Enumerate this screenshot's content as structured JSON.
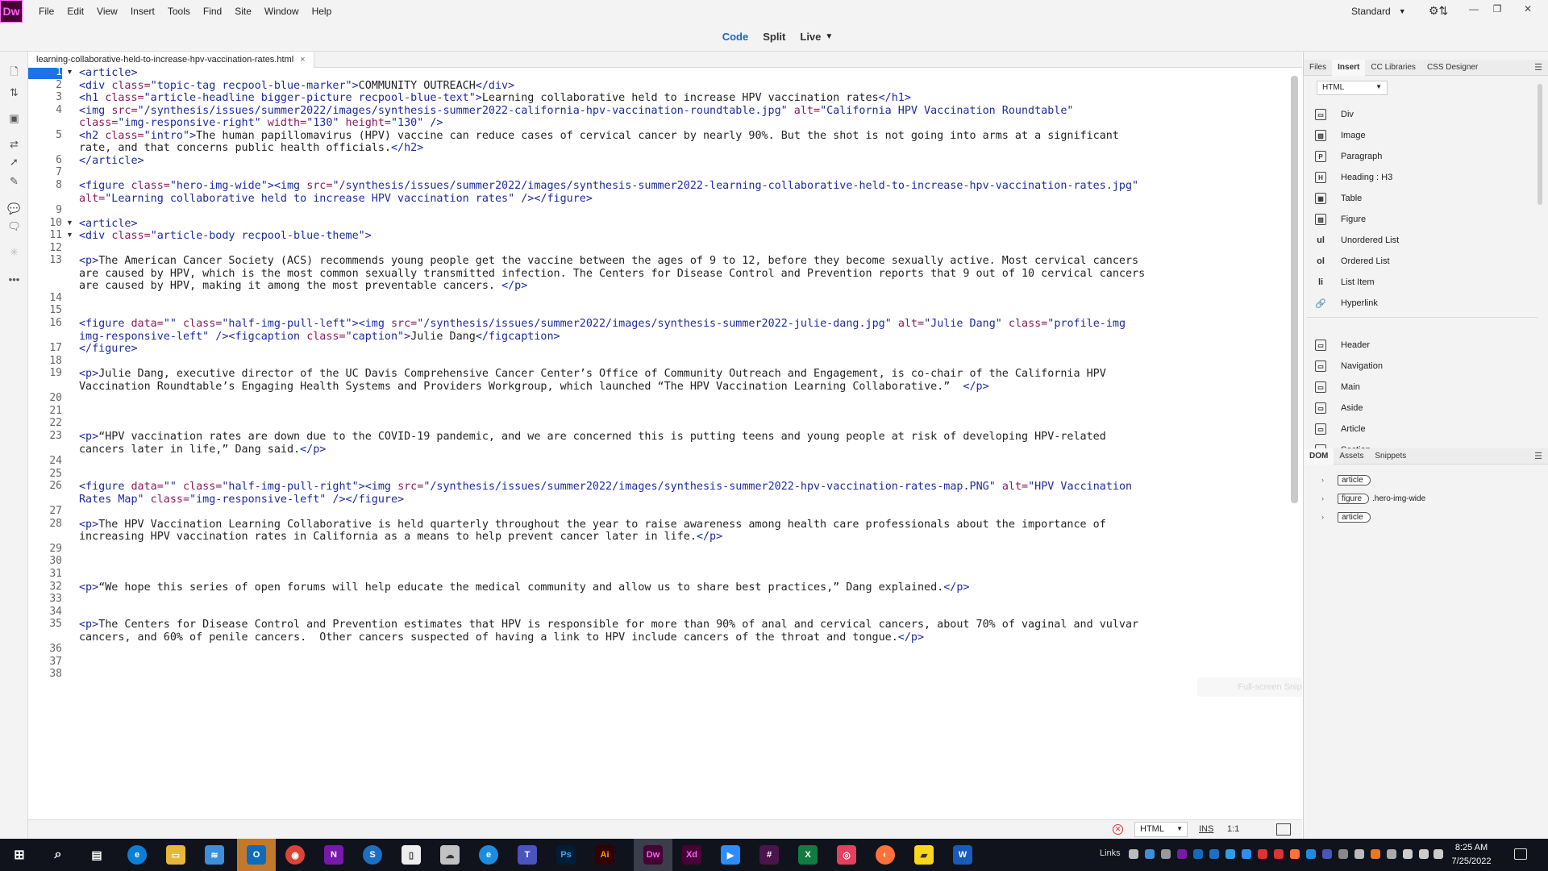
{
  "app": {
    "logo": "Dw",
    "workspace": "Standard"
  },
  "menu": [
    "File",
    "Edit",
    "View",
    "Insert",
    "Tools",
    "Find",
    "Site",
    "Window",
    "Help"
  ],
  "views": {
    "code": "Code",
    "split": "Split",
    "live": "Live"
  },
  "document": {
    "tab_name": "learning-collaborative-held-to-increase-hpv-vaccination-rates.html"
  },
  "editor": {
    "line_numbers": [
      "1",
      "2",
      "3",
      "4",
      "5",
      "6",
      "7",
      "8",
      "9",
      "10",
      "11",
      "12",
      "13",
      "14",
      "15",
      "16",
      "17",
      "18",
      "19",
      "20",
      "21",
      "22",
      "23",
      "24",
      "25",
      "26",
      "27",
      "28",
      "29",
      "30",
      "31",
      "32",
      "33",
      "34",
      "35",
      "36",
      "37",
      "38"
    ],
    "code_lines": [
      [
        [
          "tg",
          "<article>"
        ]
      ],
      [
        [
          "tg",
          "<div "
        ],
        [
          "at",
          "class="
        ],
        [
          "vl",
          "\"topic-tag recpool-blue-marker\""
        ],
        [
          "tg",
          ">"
        ],
        [
          "tx",
          "COMMUNITY OUTREACH"
        ],
        [
          "tg",
          "</div>"
        ]
      ],
      [
        [
          "tg",
          "<h1 "
        ],
        [
          "at",
          "class="
        ],
        [
          "vl",
          "\"article-headline bigger-picture recpool-blue-text\""
        ],
        [
          "tg",
          ">"
        ],
        [
          "tx",
          "Learning collaborative held to increase HPV vaccination rates"
        ],
        [
          "tg",
          "</h1>"
        ]
      ],
      [
        [
          "tg",
          "<img "
        ],
        [
          "at",
          "src="
        ],
        [
          "vl",
          "\"/synthesis/issues/summer2022/images/synthesis-summer2022-california-hpv-vaccination-roundtable.jpg\""
        ],
        [
          "at",
          " alt="
        ],
        [
          "vl",
          "\"California HPV Vaccination Roundtable\""
        ]
      ],
      [
        [
          "at",
          "class="
        ],
        [
          "vl",
          "\"img-responsive-right\""
        ],
        [
          "at",
          " width="
        ],
        [
          "vl",
          "\"130\""
        ],
        [
          "at",
          " height="
        ],
        [
          "vl",
          "\"130\""
        ],
        [
          "tg",
          " />"
        ]
      ],
      [
        [
          "tg",
          "<h2 "
        ],
        [
          "at",
          "class="
        ],
        [
          "vl",
          "\"intro\""
        ],
        [
          "tg",
          ">"
        ],
        [
          "tx",
          "The human papillomavirus (HPV) vaccine can reduce cases of cervical cancer by nearly 90%. But the shot is not going into arms at a significant"
        ]
      ],
      [
        [
          "tx",
          "rate, and that concerns public health officials."
        ],
        [
          "tg",
          "</h2>"
        ]
      ],
      [
        [
          "tg",
          "</article>"
        ]
      ],
      [],
      [
        [
          "tg",
          "<figure "
        ],
        [
          "at",
          "class="
        ],
        [
          "vl",
          "\"hero-img-wide\""
        ],
        [
          "tg",
          ">"
        ],
        [
          "tg",
          "<img "
        ],
        [
          "at",
          "src="
        ],
        [
          "vl",
          "\"/synthesis/issues/summer2022/images/synthesis-summer2022-learning-collaborative-held-to-increase-hpv-vaccination-rates.jpg\""
        ]
      ],
      [
        [
          "at",
          "alt="
        ],
        [
          "vl",
          "\"Learning collaborative held to increase HPV vaccination rates\""
        ],
        [
          "tg",
          " /></figure>"
        ]
      ],
      [],
      [
        [
          "tg",
          "<article>"
        ]
      ],
      [
        [
          "tg",
          "<div "
        ],
        [
          "at",
          "class="
        ],
        [
          "vl",
          "\"article-body recpool-blue-theme\""
        ],
        [
          "tg",
          ">"
        ]
      ],
      [],
      [
        [
          "tg",
          "<p>"
        ],
        [
          "tx",
          "The American Cancer Society (ACS) recommends young people get the vaccine between the ages of 9 to 12, before they become sexually active. Most cervical cancers"
        ]
      ],
      [
        [
          "tx",
          "are caused by HPV, which is the most common sexually transmitted infection. The Centers for Disease Control and Prevention reports that 9 out of 10 cervical cancers"
        ]
      ],
      [
        [
          "tx",
          "are caused by HPV, making it among the most preventable cancers. "
        ],
        [
          "tg",
          "</p>"
        ]
      ],
      [],
      [],
      [
        [
          "tg",
          "<figure "
        ],
        [
          "at",
          "data="
        ],
        [
          "vl",
          "\"\""
        ],
        [
          "at",
          " class="
        ],
        [
          "vl",
          "\"half-img-pull-left\""
        ],
        [
          "tg",
          ">"
        ],
        [
          "tg",
          "<img "
        ],
        [
          "at",
          "src="
        ],
        [
          "vl",
          "\"/synthesis/issues/summer2022/images/synthesis-summer2022-julie-dang.jpg\""
        ],
        [
          "at",
          " alt="
        ],
        [
          "vl",
          "\"Julie Dang\""
        ],
        [
          "at",
          " class="
        ],
        [
          "vl",
          "\"profile-img"
        ]
      ],
      [
        [
          "vl",
          "img-responsive-left\""
        ],
        [
          "tg",
          " /><figcaption "
        ],
        [
          "at",
          "class="
        ],
        [
          "vl",
          "\"caption\""
        ],
        [
          "tg",
          ">"
        ],
        [
          "tx",
          "Julie Dang"
        ],
        [
          "tg",
          "</figcaption>"
        ]
      ],
      [
        [
          "tg",
          "</figure>"
        ]
      ],
      [],
      [
        [
          "tg",
          "<p>"
        ],
        [
          "tx",
          "Julie Dang, executive director of the UC Davis Comprehensive Cancer Center’s Office of Community Outreach and Engagement, is co-chair of the California HPV"
        ]
      ],
      [
        [
          "tx",
          "Vaccination Roundtable’s Engaging Health Systems and Providers Workgroup, which launched “The HPV Vaccination Learning Collaborative.”  "
        ],
        [
          "tg",
          "</p>"
        ]
      ],
      [],
      [],
      [],
      [
        [
          "tg",
          "<p>"
        ],
        [
          "tx",
          "“HPV vaccination rates are down due to the COVID-19 pandemic, and we are concerned this is putting teens and young people at risk of developing HPV-related"
        ]
      ],
      [
        [
          "tx",
          "cancers later in life,” Dang said."
        ],
        [
          "tg",
          "</p>"
        ]
      ],
      [],
      [],
      [
        [
          "tg",
          "<figure "
        ],
        [
          "at",
          "data="
        ],
        [
          "vl",
          "\"\""
        ],
        [
          "at",
          " class="
        ],
        [
          "vl",
          "\"half-img-pull-right\""
        ],
        [
          "tg",
          ">"
        ],
        [
          "tg",
          "<img "
        ],
        [
          "at",
          "src="
        ],
        [
          "vl",
          "\"/synthesis/issues/summer2022/images/synthesis-summer2022-hpv-vaccination-rates-map.PNG\""
        ],
        [
          "at",
          " alt="
        ],
        [
          "vl",
          "\"HPV Vaccination"
        ]
      ],
      [
        [
          "vl",
          "Rates Map\""
        ],
        [
          "at",
          " class="
        ],
        [
          "vl",
          "\"img-responsive-left\""
        ],
        [
          "tg",
          " /></figure>"
        ]
      ],
      [],
      [
        [
          "tg",
          "<p>"
        ],
        [
          "tx",
          "The HPV Vaccination Learning Collaborative is held quarterly throughout the year to raise awareness among health care professionals about the importance of"
        ]
      ],
      [
        [
          "tx",
          "increasing HPV vaccination rates in California as a means to help prevent cancer later in life."
        ],
        [
          "tg",
          "</p>"
        ]
      ],
      [],
      [],
      [],
      [
        [
          "tg",
          "<p>"
        ],
        [
          "tx",
          "“We hope this series of open forums will help educate the medical community and allow us to share best practices,” Dang explained."
        ],
        [
          "tg",
          "</p>"
        ]
      ],
      [],
      [],
      [
        [
          "tg",
          "<p>"
        ],
        [
          "tx",
          "The Centers for Disease Control and Prevention estimates that HPV is responsible for more than 90% of anal and cervical cancers, about 70% of vaginal and vulvar"
        ]
      ],
      [
        [
          "tx",
          "cancers, and 60% of penile cancers.  Other cancers suspected of having a link to HPV include cancers of the throat and tongue."
        ],
        [
          "tg",
          "</p>"
        ]
      ],
      [],
      [],
      []
    ],
    "snip_hint": "Full-screen Snip"
  },
  "status": {
    "language": "HTML",
    "mode": "INS",
    "position": "1:1"
  },
  "panel_tabs": [
    "Files",
    "Insert",
    "CC Libraries",
    "CSS Designer"
  ],
  "insert": {
    "category": "HTML",
    "items": [
      "Div",
      "Image",
      "Paragraph",
      "Heading : H3",
      "Table",
      "Figure",
      "Unordered List",
      "Ordered List",
      "List Item",
      "Hyperlink",
      "Header",
      "Navigation",
      "Main",
      "Aside",
      "Article",
      "Section"
    ]
  },
  "dom_tabs": [
    "DOM",
    "Assets",
    "Snippets"
  ],
  "dom": [
    {
      "tag": "article",
      "cls": ""
    },
    {
      "tag": "figure",
      "cls": ".hero-img-wide"
    },
    {
      "tag": "article",
      "cls": ""
    }
  ],
  "taskbar": {
    "links": "Links",
    "time": "8:25 AM",
    "date": "7/25/2022"
  },
  "colors": {
    "accent": "#1b63c6",
    "dw_brand": "#470137",
    "tag": "#1e2b9e",
    "attr": "#8b1a58",
    "taskbar": "#10131c"
  }
}
